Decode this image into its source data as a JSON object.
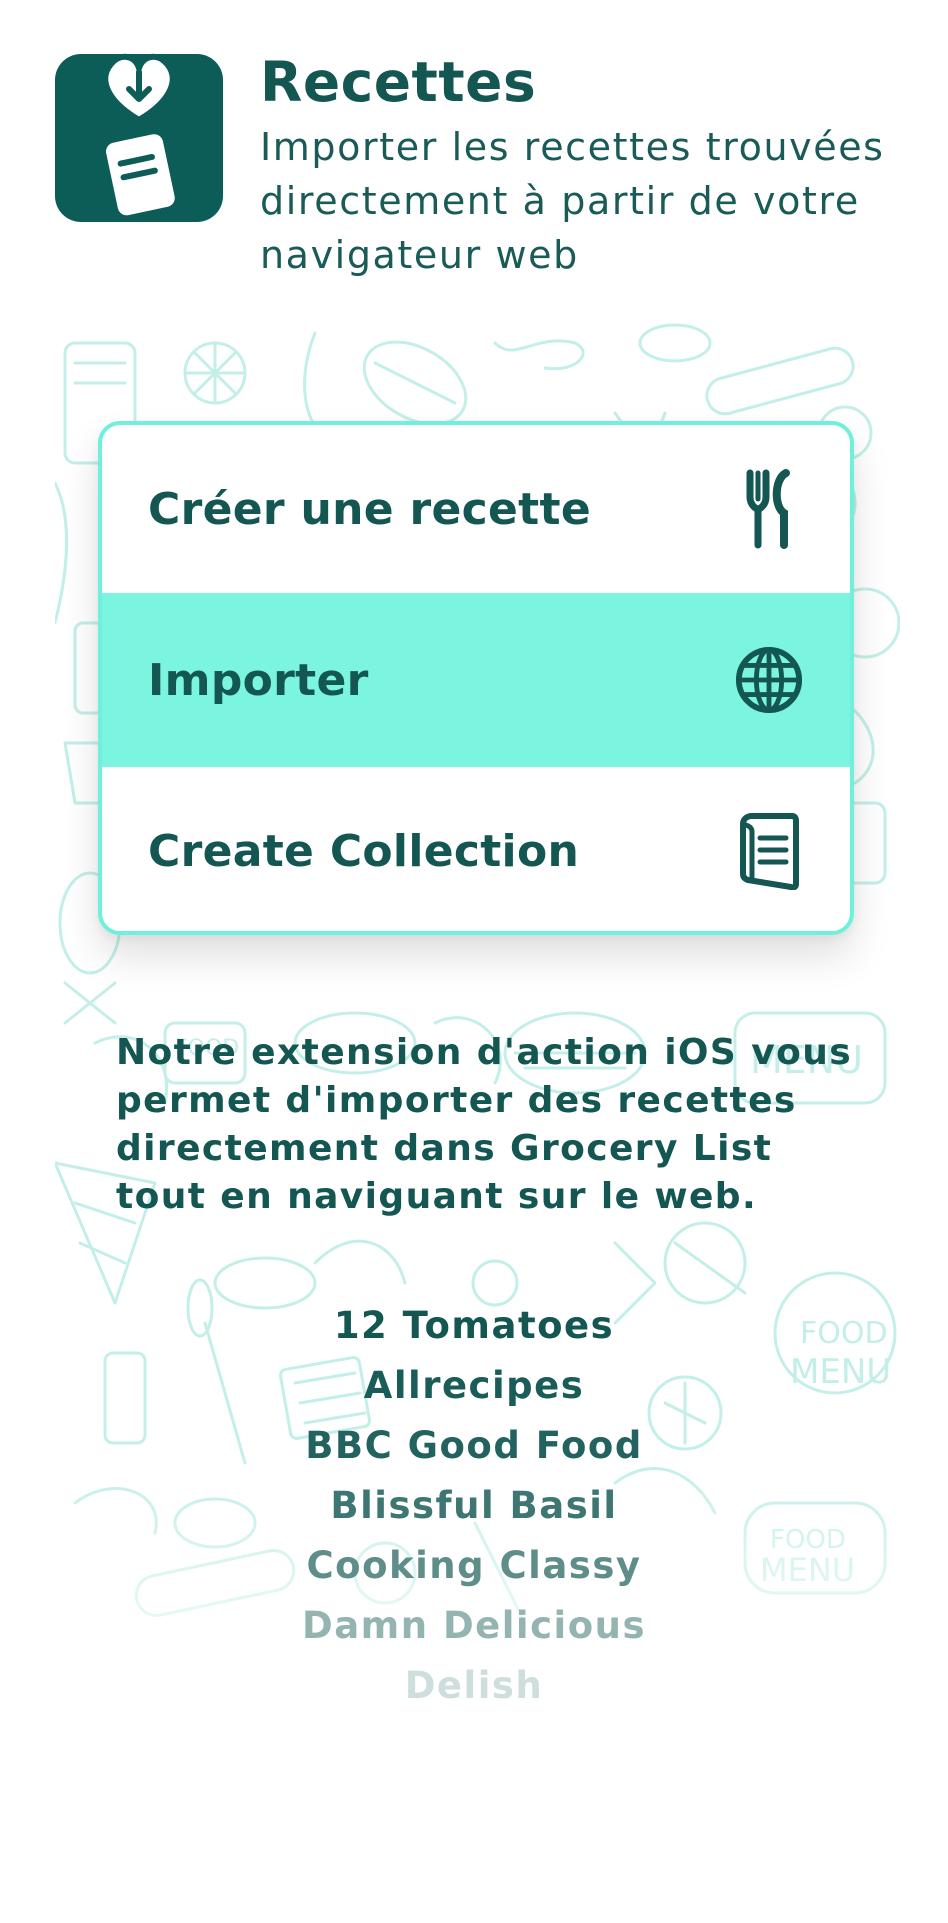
{
  "header": {
    "icon": "recipe-download-icon",
    "title": "Recettes",
    "subtitle": "Importer les recettes trouvées directement à partir de votre navigateur web"
  },
  "menu": {
    "items": [
      {
        "label": "Créer une recette",
        "icon": "fork-knife-icon"
      },
      {
        "label": "Importer",
        "icon": "globe-icon",
        "highlighted": true
      },
      {
        "label": "Create Collection",
        "icon": "collection-book-icon"
      }
    ]
  },
  "description": "Notre extension d'action iOS vous permet d'importer des recettes directement dans Grocery List tout en naviguant sur le web.",
  "sites": [
    "12 Tomatoes",
    "Allrecipes",
    "BBC Good Food",
    "Blissful Basil",
    "Cooking Classy",
    "Damn Delicious",
    "Delish"
  ],
  "colors": {
    "primary": "#135652",
    "icon_bg": "#0c5c58",
    "highlight": "#7cf5e0",
    "card_border": "#6ff0dc",
    "doodle": "#bdeee6"
  }
}
